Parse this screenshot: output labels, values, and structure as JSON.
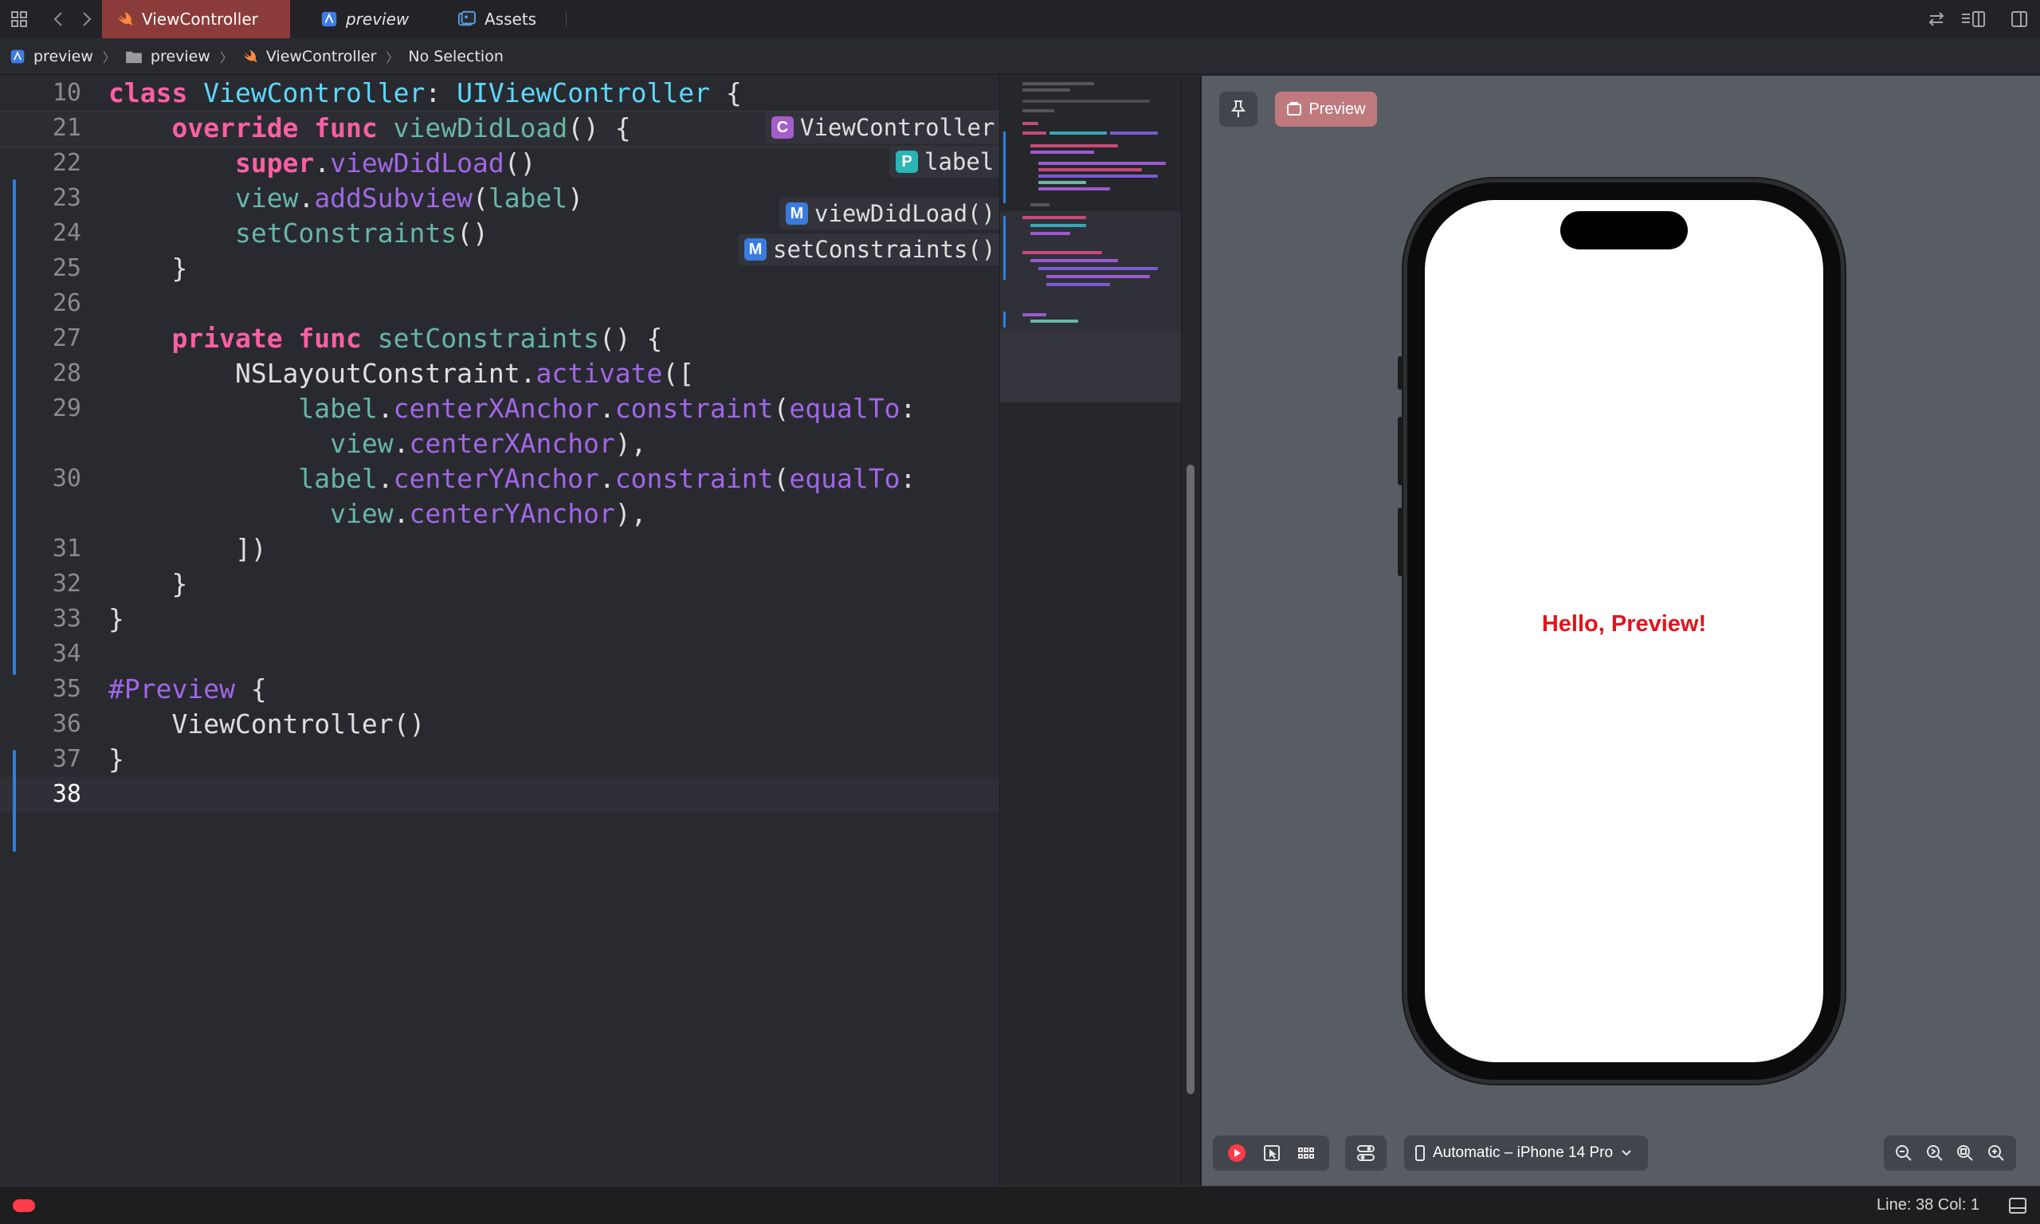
{
  "tabs": [
    {
      "label": "ViewController",
      "active": true,
      "icon": "swift-icon"
    },
    {
      "label": "preview",
      "active": false,
      "icon": "project-icon"
    },
    {
      "label": "Assets",
      "active": false,
      "icon": "asset-catalog-icon"
    }
  ],
  "breadcrumb": {
    "items": [
      "preview",
      "preview",
      "ViewController",
      "No Selection"
    ]
  },
  "editor": {
    "lines": [
      {
        "n": "10",
        "tokens": [
          [
            "k",
            "class "
          ],
          [
            "t",
            "ViewController"
          ],
          [
            "pl",
            ": "
          ],
          [
            "t",
            "UIViewController"
          ],
          [
            "pl",
            " {"
          ]
        ]
      },
      {
        "n": "21",
        "tokens": [
          [
            "pl",
            "    "
          ],
          [
            "k",
            "override func "
          ],
          [
            "f",
            "viewDidLoad"
          ],
          [
            "pl",
            "() {"
          ]
        ]
      },
      {
        "n": "22",
        "tokens": [
          [
            "pl",
            "        "
          ],
          [
            "k",
            "super"
          ],
          [
            "pl",
            "."
          ],
          [
            "m",
            "viewDidLoad"
          ],
          [
            "pl",
            "()"
          ]
        ]
      },
      {
        "n": "23",
        "tokens": [
          [
            "pl",
            "        "
          ],
          [
            "f",
            "view"
          ],
          [
            "pl",
            "."
          ],
          [
            "m",
            "addSubview"
          ],
          [
            "pl",
            "("
          ],
          [
            "f",
            "label"
          ],
          [
            "pl",
            ")"
          ]
        ]
      },
      {
        "n": "24",
        "tokens": [
          [
            "pl",
            "        "
          ],
          [
            "f",
            "setConstraints"
          ],
          [
            "pl",
            "()"
          ]
        ]
      },
      {
        "n": "25",
        "tokens": [
          [
            "pl",
            "    }"
          ]
        ]
      },
      {
        "n": "26",
        "tokens": [
          [
            "pl",
            ""
          ]
        ]
      },
      {
        "n": "27",
        "tokens": [
          [
            "pl",
            "    "
          ],
          [
            "k",
            "private func "
          ],
          [
            "f",
            "setConstraints"
          ],
          [
            "pl",
            "() {"
          ]
        ]
      },
      {
        "n": "28",
        "tokens": [
          [
            "pl",
            "        "
          ],
          [
            "pl",
            "NSLayoutConstraint"
          ],
          [
            "pl",
            "."
          ],
          [
            "m",
            "activate"
          ],
          [
            "pl",
            "(["
          ]
        ]
      },
      {
        "n": "29",
        "tokens": [
          [
            "pl",
            "            "
          ],
          [
            "f",
            "label"
          ],
          [
            "pl",
            "."
          ],
          [
            "m",
            "centerXAnchor"
          ],
          [
            "pl",
            "."
          ],
          [
            "m",
            "constraint"
          ],
          [
            "pl",
            "("
          ],
          [
            "m",
            "equalTo"
          ],
          [
            "pl",
            ":"
          ]
        ]
      },
      {
        "n": "",
        "tokens": [
          [
            "pl",
            "              "
          ],
          [
            "f",
            "view"
          ],
          [
            "pl",
            "."
          ],
          [
            "m",
            "centerXAnchor"
          ],
          [
            "pl",
            "),"
          ]
        ]
      },
      {
        "n": "30",
        "tokens": [
          [
            "pl",
            "            "
          ],
          [
            "f",
            "label"
          ],
          [
            "pl",
            "."
          ],
          [
            "m",
            "centerYAnchor"
          ],
          [
            "pl",
            "."
          ],
          [
            "m",
            "constraint"
          ],
          [
            "pl",
            "("
          ],
          [
            "m",
            "equalTo"
          ],
          [
            "pl",
            ":"
          ]
        ]
      },
      {
        "n": "",
        "tokens": [
          [
            "pl",
            "              "
          ],
          [
            "f",
            "view"
          ],
          [
            "pl",
            "."
          ],
          [
            "m",
            "centerYAnchor"
          ],
          [
            "pl",
            "),"
          ]
        ]
      },
      {
        "n": "31",
        "tokens": [
          [
            "pl",
            "        ])"
          ]
        ]
      },
      {
        "n": "32",
        "tokens": [
          [
            "pl",
            "    }"
          ]
        ]
      },
      {
        "n": "33",
        "tokens": [
          [
            "pl",
            "}"
          ]
        ]
      },
      {
        "n": "34",
        "tokens": [
          [
            "pl",
            ""
          ]
        ]
      },
      {
        "n": "35",
        "tokens": [
          [
            "pv",
            "#Preview"
          ],
          [
            "pl",
            " {"
          ]
        ]
      },
      {
        "n": "36",
        "tokens": [
          [
            "pl",
            "    "
          ],
          [
            "pl",
            "ViewController"
          ],
          [
            "pl",
            "()"
          ]
        ]
      },
      {
        "n": "37",
        "tokens": [
          [
            "pl",
            "}"
          ]
        ]
      },
      {
        "n": "38",
        "tokens": [
          [
            "pl",
            ""
          ]
        ],
        "current": true
      }
    ],
    "symbols": [
      {
        "badge": "C",
        "name": "ViewController",
        "color": "#a55ccd"
      },
      {
        "badge": "P",
        "name": "label",
        "color": "#2bb5b3"
      },
      {
        "badge": "M",
        "name": "viewDidLoad()",
        "color": "#3a7be0"
      },
      {
        "badge": "M",
        "name": "setConstraints()",
        "color": "#3a7be0"
      }
    ]
  },
  "canvas": {
    "preview_label": "Preview",
    "hello_text": "Hello, Preview!",
    "device": "Automatic – iPhone 14 Pro"
  },
  "status": {
    "position": "Line: 38  Col: 1"
  },
  "colors": {
    "accent_tab": "#8b3b39",
    "preview_button": "#c07a7e",
    "label_text": "#e2141a",
    "live_button": "#ff3b4a"
  }
}
